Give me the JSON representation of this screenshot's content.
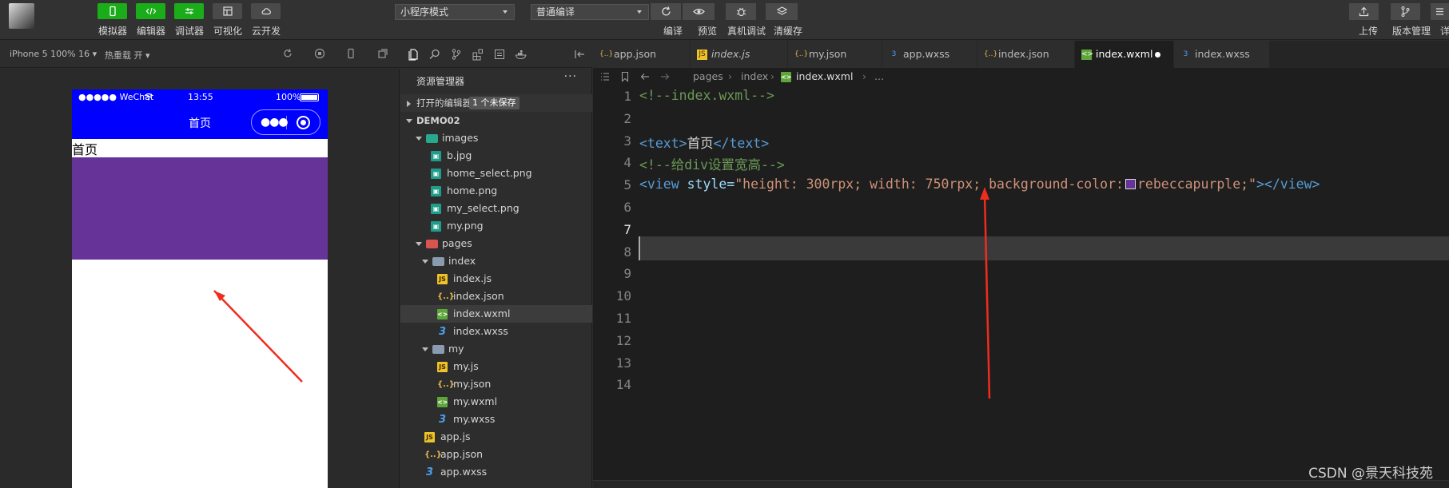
{
  "toolbar": {
    "buttons": [
      {
        "label": "模拟器",
        "icon": "phone-icon"
      },
      {
        "label": "编辑器",
        "icon": "code-icon"
      },
      {
        "label": "调试器",
        "icon": "debug-icon"
      },
      {
        "label": "可视化",
        "icon": "layout-icon"
      },
      {
        "label": "云开发",
        "icon": "cloud-icon"
      }
    ],
    "mode_select": "小程序模式",
    "compile_select": "普通编译",
    "center_labels": [
      "编译",
      "预览",
      "真机调试",
      "清缓存"
    ],
    "right_labels": [
      "上传",
      "版本管理",
      "详"
    ]
  },
  "device": {
    "model": "iPhone 5 100% 16",
    "hot_reload": "热重载 开"
  },
  "phone": {
    "carrier": "●●●●● WeChat",
    "time": "13:55",
    "battery": "100%",
    "nav_title": "首页",
    "page_text": "首页",
    "box_color": "#663399"
  },
  "explorer": {
    "title": "资源管理器",
    "more": "···",
    "open_editors": "打开的编辑器",
    "unsaved_badge": "1 个未保存",
    "project": "DEMO02",
    "rows": [
      {
        "label": "images",
        "type": "folder",
        "depth": 1,
        "open": true
      },
      {
        "label": "b.jpg",
        "type": "png",
        "depth": 2
      },
      {
        "label": "home_select.png",
        "type": "png",
        "depth": 2
      },
      {
        "label": "home.png",
        "type": "png",
        "depth": 2
      },
      {
        "label": "my_select.png",
        "type": "png",
        "depth": 2
      },
      {
        "label": "my.png",
        "type": "png",
        "depth": 2
      },
      {
        "label": "pages",
        "type": "folder",
        "depth": 1,
        "open": true
      },
      {
        "label": "index",
        "type": "folder",
        "depth": 2,
        "open": true
      },
      {
        "label": "index.js",
        "type": "js",
        "depth": 3
      },
      {
        "label": "index.json",
        "type": "json",
        "depth": 3
      },
      {
        "label": "index.wxml",
        "type": "wxml",
        "depth": 3,
        "selected": true
      },
      {
        "label": "index.wxss",
        "type": "wxss",
        "depth": 3
      },
      {
        "label": "my",
        "type": "folder",
        "depth": 2,
        "open": true
      },
      {
        "label": "my.js",
        "type": "js",
        "depth": 3
      },
      {
        "label": "my.json",
        "type": "json",
        "depth": 3
      },
      {
        "label": "my.wxml",
        "type": "wxml",
        "depth": 3
      },
      {
        "label": "my.wxss",
        "type": "wxss",
        "depth": 3
      },
      {
        "label": "app.js",
        "type": "js",
        "depth": 1
      },
      {
        "label": "app.json",
        "type": "json",
        "depth": 1
      },
      {
        "label": "app.wxss",
        "type": "wxss",
        "depth": 1
      }
    ]
  },
  "tabs": [
    {
      "label": "app.json",
      "type": "json"
    },
    {
      "label": "index.js",
      "type": "js"
    },
    {
      "label": "my.json",
      "type": "json"
    },
    {
      "label": "app.wxss",
      "type": "wxss"
    },
    {
      "label": "index.json",
      "type": "json"
    },
    {
      "label": "index.wxml",
      "type": "wxml",
      "active": true,
      "unsaved": true
    },
    {
      "label": "index.wxss",
      "type": "wxss"
    }
  ],
  "breadcrumb": [
    "pages",
    "index",
    "index.wxml",
    "..."
  ],
  "editor": {
    "line_numbers": [
      "1",
      "2",
      "3",
      "4",
      "5",
      "6",
      "7",
      "8",
      "9",
      "10",
      "11",
      "12",
      "13",
      "14"
    ],
    "current_line": "7",
    "line1": "<!--index.wxml-->",
    "line3_open": "<text>",
    "line3_text": "首页",
    "line3_close": "</text>",
    "line4": "<!--给div设置宽高-->",
    "line5_tag": "<view ",
    "line5_attr": "style=",
    "line5_str_a": "\"height: 300rpx; width: 750rpx; background-color:",
    "line5_str_b": "rebeccapurple;\"",
    "line5_close": "></view>"
  },
  "watermark": "CSDN @景天科技苑"
}
